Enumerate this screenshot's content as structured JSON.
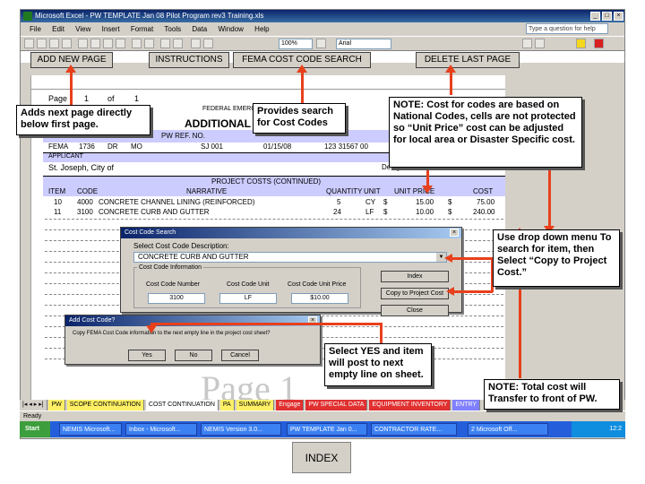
{
  "window": {
    "title": "Microsoft Excel - PW TEMPLATE Jan 08 Pilot Program rev3 Training.xls",
    "help_placeholder": "Type a question for help",
    "zoom": "100%",
    "font": "Arial"
  },
  "menu": [
    "File",
    "Edit",
    "View",
    "Insert",
    "Format",
    "Tools",
    "Data",
    "Window",
    "Help"
  ],
  "macros": {
    "add_new_page": "ADD NEW PAGE",
    "instructions": "INSTRUCTIONS",
    "fema_cost_code_search": "FEMA COST CODE SEARCH",
    "delete_last_page": "DELETE LAST PAGE"
  },
  "sheet": {
    "page_label": "Page",
    "page_num": "1",
    "of_label": "of",
    "page_total": "1",
    "federal_label": "FEDERAL EMERGENCY",
    "form_title": "ADDITIONAL",
    "pw_ref_label": "PW REF. NO.",
    "row_fema": "FEMA",
    "row_disaster": "1736",
    "row_dr": "DR",
    "row_mo": "MO",
    "row_ref": "SJ 001",
    "row_date": "01/15/08",
    "row_fips": "123 31567 00",
    "applicant_label": "APPLICANT",
    "applicant": "St. Joseph, City of",
    "designation": "Designation",
    "project_costs": "PROJECT COSTS (CONTINUED)",
    "headers": [
      "ITEM",
      "CODE",
      "NARRATIVE",
      "QUANTITY",
      "UNIT",
      "UNIT PRICE",
      "COST"
    ],
    "rows": [
      [
        "10",
        "4000",
        "CONCRETE CHANNEL LINING (REINFORCED)",
        "5",
        "CY",
        "$",
        "15.00",
        "$",
        "75.00"
      ],
      [
        "11",
        "3100",
        "CONCRETE CURB AND GUTTER",
        "24",
        "LF",
        "$",
        "10.00",
        "$",
        "240.00"
      ]
    ],
    "watermark": "Page 1"
  },
  "cost_dialog": {
    "title": "Cost Code Search",
    "select_label": "Select Cost Code Description:",
    "selected": "CONCRETE CURB AND GUTTER",
    "info_label": "Cost Code Information",
    "col_number": "Cost Code Number",
    "col_unit": "Cost Code Unit",
    "col_price": "Cost Code Unit Price",
    "number": "3100",
    "unit": "LF",
    "price": "$10.00",
    "btn_index": "Index",
    "btn_copy": "Copy to Project Cost",
    "btn_close": "Close"
  },
  "add_dialog": {
    "title": "Add Cost Code?",
    "message": "Copy FEMA Cost Code information to the next empty line in the project cost sheet?",
    "yes": "Yes",
    "no": "No",
    "cancel": "Cancel"
  },
  "tabs": [
    "PW",
    "SCOPE CONTINUATION",
    "COST CONTINUATION",
    "PA",
    "SUMMARY",
    "Engage",
    "PW SPECIAL DATA",
    "EQUIPMENT INVENTORY",
    "ENTRY"
  ],
  "status": "Ready",
  "taskbar": {
    "start": "Start",
    "items": [
      "NEMIS Microsoft...",
      "Inbox - Microsoft...",
      "NEMIS Version 3.0...",
      "PW TEMPLATE Jan 0...",
      "CONTRACTOR RATE..."
    ],
    "lang": "2 Microsoft Off...",
    "clock": "12:2"
  },
  "callouts": {
    "add_page": "Adds next page directly below first page.",
    "search": "Provides search for Cost Codes",
    "note_cost": "NOTE: Cost for codes are based on National Codes, cells are not protected so “Unit Price” cost can be adjusted for local area or Disaster Specific cost.",
    "dropdown": "Use drop down menu To search for item, then Select “Copy to Project Cost.”",
    "select_yes": "Select YES and item will post to next empty line on sheet.",
    "total": "NOTE: Total cost will Transfer to front of PW."
  },
  "index_button": "INDEX",
  "colors": {
    "arrow": "#e8401c",
    "band": "#ccccff",
    "title": "#0a246a"
  }
}
